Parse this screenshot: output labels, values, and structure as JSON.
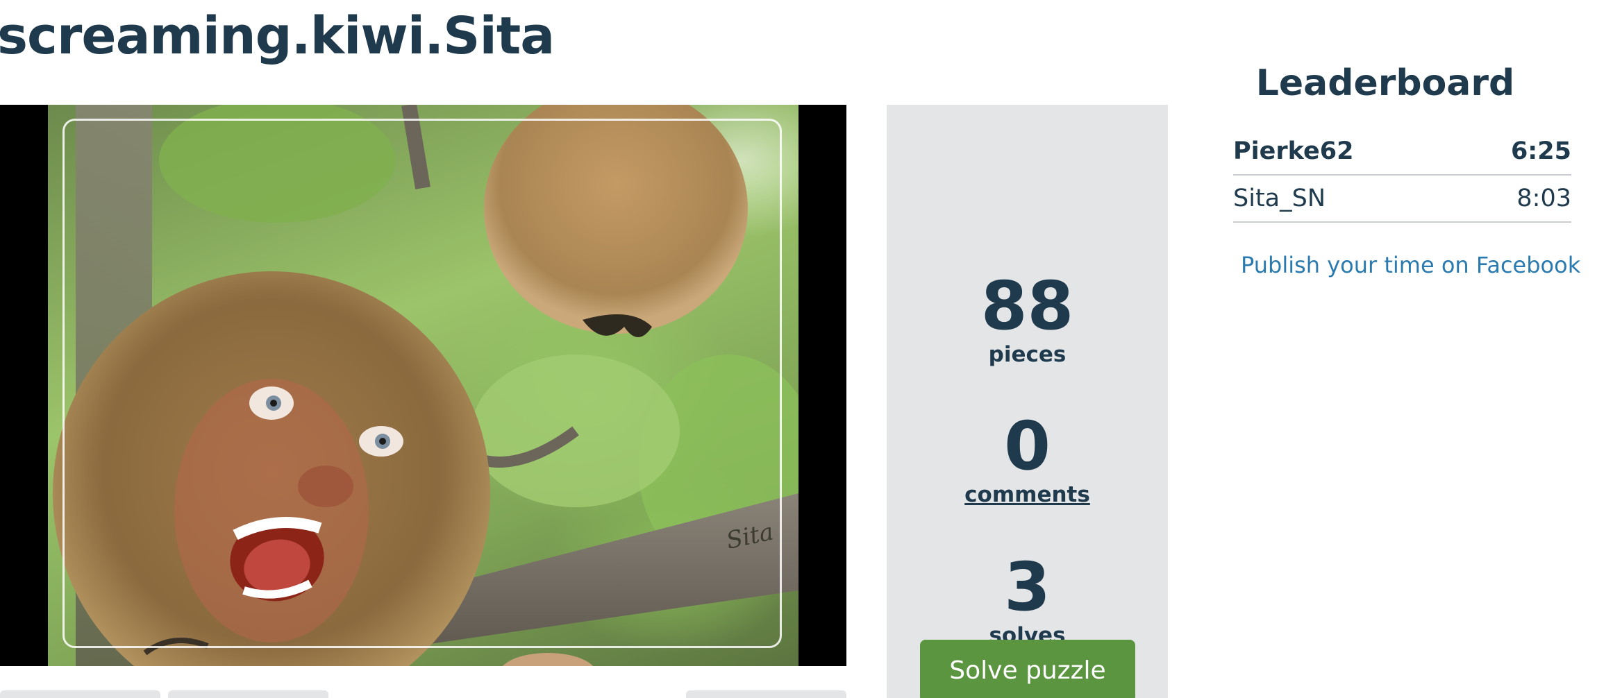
{
  "puzzle": {
    "title": "screaming.kiwi.Sita",
    "image_alt": "screaming kiwi with face",
    "watermark": "Sita"
  },
  "stats": {
    "pieces": {
      "value": "88",
      "label": "pieces"
    },
    "comments": {
      "value": "0",
      "label": "comments"
    },
    "solves": {
      "value": "3",
      "label": "solves"
    }
  },
  "actions": {
    "solve_label": "Solve puzzle"
  },
  "leaderboard": {
    "title": "Leaderboard",
    "rows": [
      {
        "name": "Pierke62",
        "time": "6:25"
      },
      {
        "name": "Sita_SN",
        "time": "8:03"
      }
    ],
    "publish_label": "Publish your time on Facebook"
  },
  "colors": {
    "text": "#1f3a4d",
    "panel": "#e4e5e7",
    "button": "#5c9540",
    "link": "#2a7ab0"
  }
}
